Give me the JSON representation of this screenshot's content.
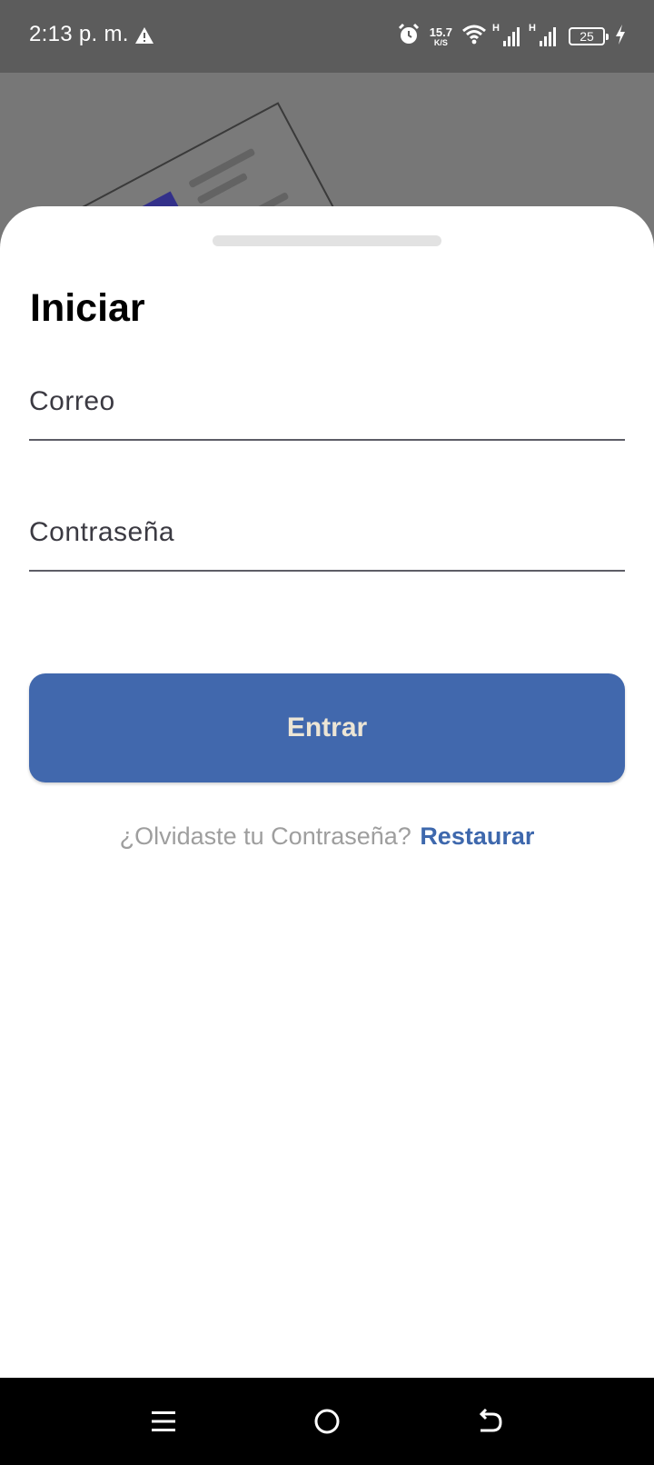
{
  "status_bar": {
    "time": "2:13 p. m.",
    "net_speed_value": "15.7",
    "net_speed_unit": "K/S",
    "signal1_type": "H",
    "signal2_type": "H",
    "battery_level": "25",
    "icons": [
      "warning-icon",
      "alarm-icon",
      "wifi-icon",
      "signal-icon",
      "signal-icon",
      "battery-icon",
      "charging-icon"
    ]
  },
  "login": {
    "title": "Iniciar",
    "email_placeholder": "Correo",
    "password_placeholder": "Contraseña",
    "submit_label": "Entrar",
    "forgot_text": "¿Olvidaste tu Contraseña?",
    "restore_link": "Restaurar"
  },
  "nav_bar": {
    "icons": [
      "menu-icon",
      "home-icon",
      "back-icon"
    ]
  },
  "colors": {
    "primary": "#4168ad",
    "link": "#3e68ad",
    "button_text": "#ece5d5",
    "overlay": "#777777",
    "illustration_accent": "#33308a"
  }
}
